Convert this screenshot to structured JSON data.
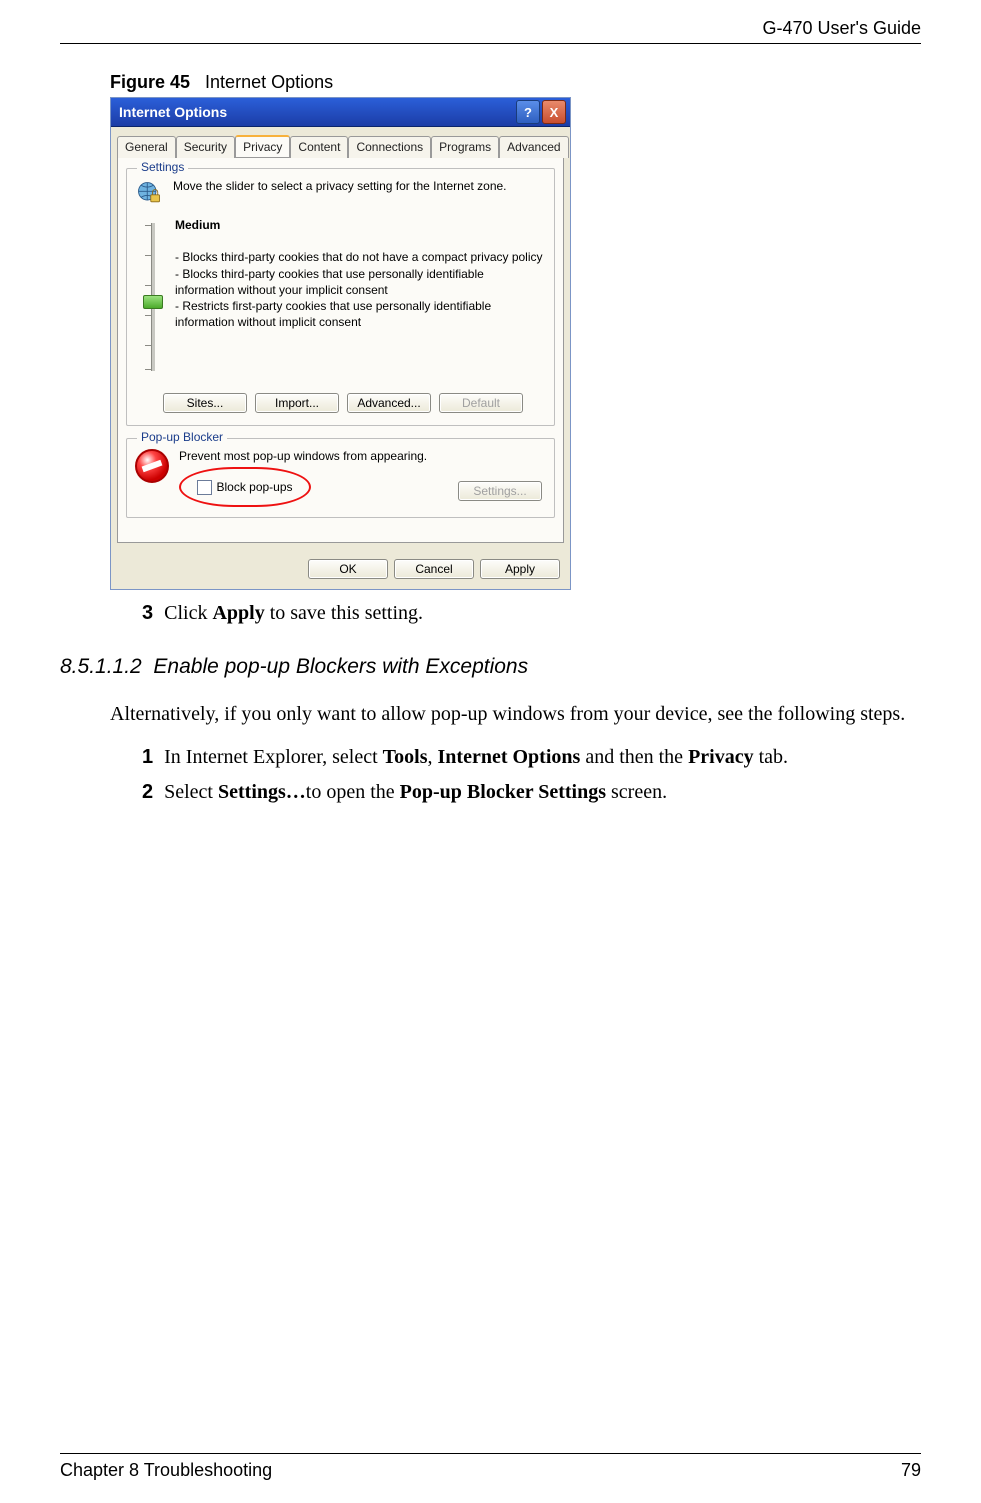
{
  "header": {
    "guide_name": "G-470 User's Guide"
  },
  "figure": {
    "label": "Figure 45",
    "title": "Internet Options"
  },
  "dialog": {
    "title": "Internet Options",
    "tabs": [
      "General",
      "Security",
      "Privacy",
      "Content",
      "Connections",
      "Programs",
      "Advanced"
    ],
    "active_tab_index": 2,
    "settings_group": {
      "label": "Settings",
      "intro": "Move the slider to select a privacy setting for the Internet zone.",
      "level": "Medium",
      "bullets": [
        "- Blocks third-party cookies that do not have a compact privacy policy",
        "- Blocks third-party cookies that use personally identifiable information without your implicit consent",
        "- Restricts first-party cookies that use personally identifiable information without implicit consent"
      ],
      "buttons": {
        "sites": "Sites...",
        "import": "Import...",
        "advanced": "Advanced...",
        "default": "Default"
      }
    },
    "popup_group": {
      "label": "Pop-up Blocker",
      "desc": "Prevent most pop-up windows from appearing.",
      "checkbox_label": "Block pop-ups",
      "settings_btn": "Settings..."
    },
    "buttons": {
      "ok": "OK",
      "cancel": "Cancel",
      "apply": "Apply"
    }
  },
  "step3": {
    "num": "3",
    "pre": "Click ",
    "bold": "Apply",
    "post": " to save this setting."
  },
  "subheading": {
    "num": "8.5.1.1.2",
    "title": "Enable pop-up Blockers with Exceptions"
  },
  "alt_intro": "Alternatively, if you only want to allow pop-up windows from your device, see the following steps.",
  "steps": [
    {
      "num": "1",
      "parts": [
        "In Internet Explorer, select ",
        "Tools",
        ", ",
        "Internet Options",
        " and then the ",
        "Privacy",
        " tab."
      ]
    },
    {
      "num": "2",
      "parts": [
        "Select ",
        "Settings…",
        "to open the ",
        "Pop-up Blocker Settings",
        " screen."
      ]
    }
  ],
  "footer": {
    "chapter": "Chapter 8 Troubleshooting",
    "page": "79"
  }
}
